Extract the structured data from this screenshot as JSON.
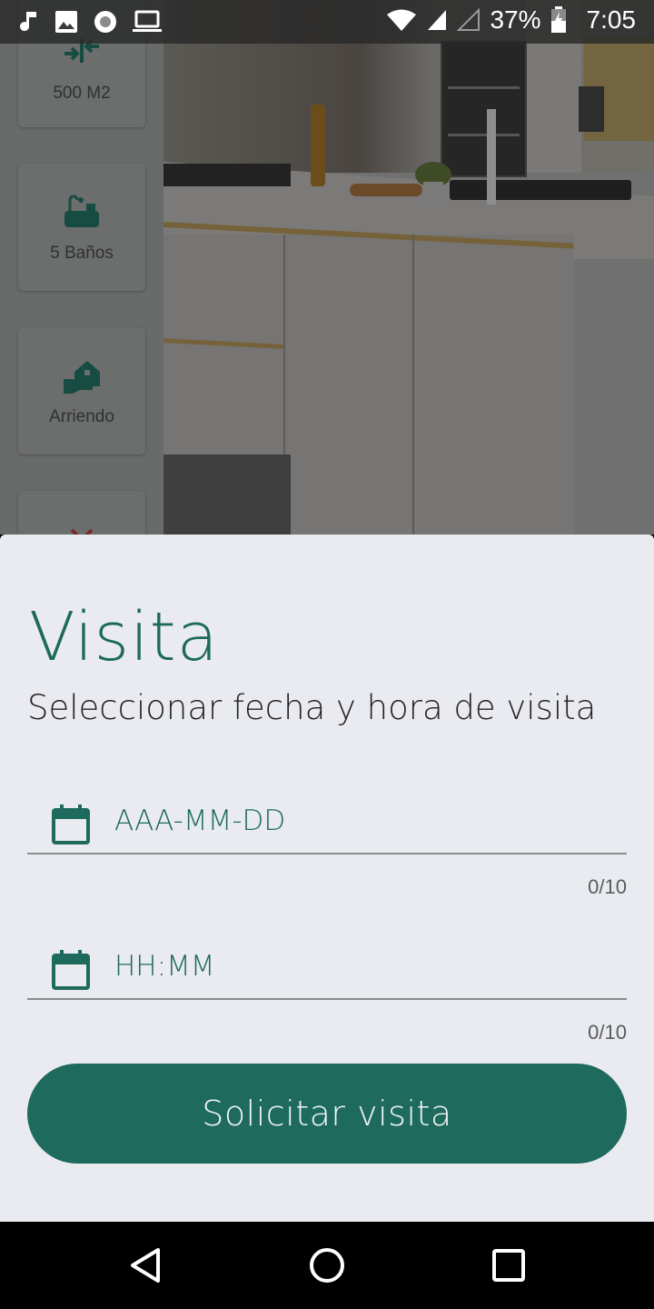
{
  "status_bar": {
    "battery_percent": "37%",
    "time": "7:05",
    "icons": [
      "music-note-icon",
      "image-icon",
      "record-icon",
      "laptop-icon",
      "wifi-icon",
      "signal-icon",
      "signal-empty-icon",
      "battery-charging-icon"
    ]
  },
  "features": [
    {
      "icon": "area-arrows-icon",
      "label": "500 M2"
    },
    {
      "icon": "bathtub-icon",
      "label": "5 Baños"
    },
    {
      "icon": "rent-house-icon",
      "label": "Arriendo"
    },
    {
      "icon": "close-x-icon",
      "label": ""
    }
  ],
  "visit_sheet": {
    "title": "Visita",
    "subtitle": "Seleccionar fecha y hora de visita",
    "date_field": {
      "icon": "calendar-icon",
      "placeholder": "AAA-MM-DD",
      "value": "",
      "counter": "0/10"
    },
    "time_field": {
      "icon": "calendar-icon",
      "placeholder": "HH:MM",
      "value": "",
      "counter": "0/10"
    },
    "submit_label": "Solicitar visita"
  },
  "nav_bar": {
    "buttons": [
      "back-icon",
      "home-icon",
      "recents-icon"
    ]
  },
  "colors": {
    "accent": "#1e6b5d",
    "sheet_background": "#eaebf0",
    "danger": "#8a2a2a"
  }
}
